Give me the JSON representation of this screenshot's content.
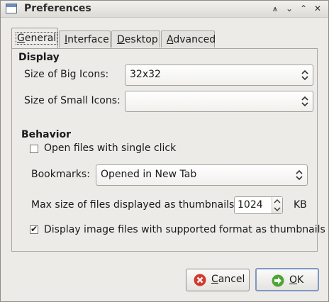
{
  "window": {
    "title": "Preferences"
  },
  "titlebar_buttons": [
    "⩚",
    "⌄",
    "⌃",
    "✕"
  ],
  "tabs": [
    {
      "label": "General",
      "mnemonic": "G",
      "rest": "eneral",
      "active": true
    },
    {
      "label": "Interface",
      "mnemonic": "I",
      "rest": "nterface"
    },
    {
      "label": "Desktop",
      "mnemonic": "D",
      "rest": "esktop"
    },
    {
      "label": "Advanced",
      "mnemonic": "A",
      "rest": "dvanced"
    }
  ],
  "display": {
    "heading": "Display",
    "big_icons_label": "Size of Big Icons:",
    "big_icons_value": "32x32",
    "small_icons_label": "Size of Small Icons:",
    "small_icons_value": ""
  },
  "behavior": {
    "heading": "Behavior",
    "single_click_label": "Open files with single click",
    "single_click_checked": false,
    "bookmarks_label": "Bookmarks:",
    "bookmarks_value": "Opened in New Tab",
    "thumb_size_label": "Max size of files displayed as thumbnails:",
    "thumb_size_value": "1024",
    "thumb_size_unit": "KB",
    "image_thumbs_label": "Display image files with supported format as thumbnails",
    "image_thumbs_checked": true
  },
  "buttons": {
    "cancel": {
      "mnemonic": "C",
      "rest": "ancel",
      "label": "Cancel"
    },
    "ok": {
      "mnemonic": "O",
      "rest": "K",
      "label": "OK"
    }
  },
  "icons": {
    "cancel": "cancel-icon",
    "ok": "ok-arrow-icon"
  },
  "colors": {
    "cancel_icon": "#d23a2e",
    "ok_icon": "#4da534",
    "default_border": "#7d98c4"
  }
}
